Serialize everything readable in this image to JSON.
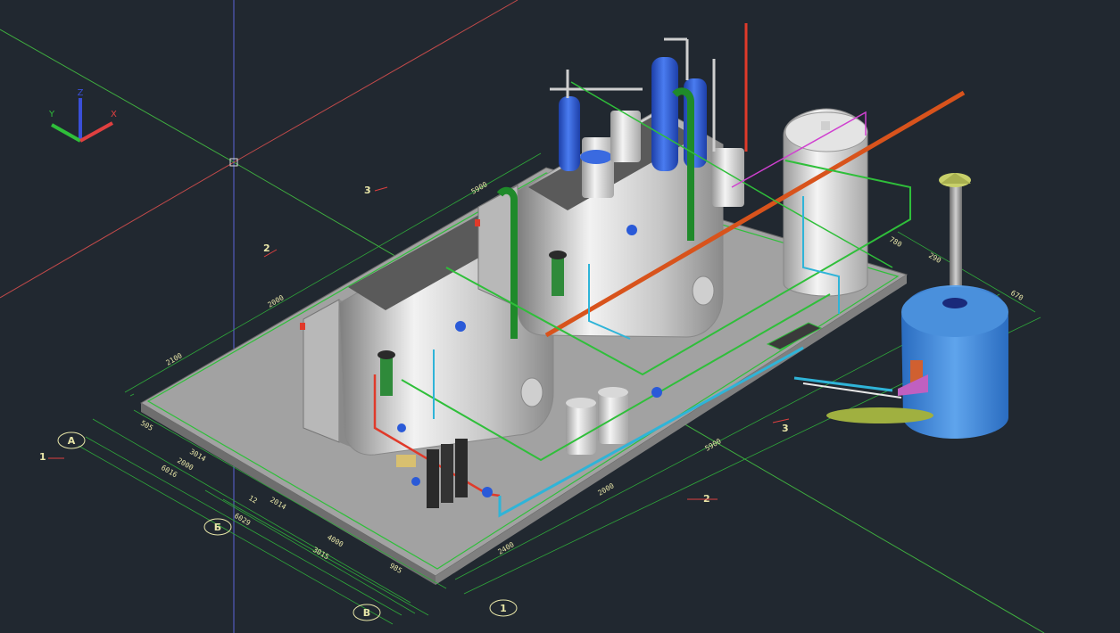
{
  "viewport": {
    "background": "#212830",
    "colors": {
      "platform": "#9c9c9c",
      "platform_edge": "#6e6e6e",
      "boiler": "#d8d8d8",
      "boiler_dark": "#8e8e8e",
      "tank_blue": "#2d5fd6",
      "furnace_blue": "#3b86d8",
      "pipe_red": "#e03a2a",
      "pipe_green": "#2fbf3a",
      "pipe_cyan": "#2fb4d8",
      "pipe_orange": "#d8531c",
      "dim_green": "#2fa83a",
      "dim_text": "#e8e6a8",
      "grid_red": "#c24a4a",
      "grid_green": "#3fae3f",
      "grid_blue": "#5c63d8"
    }
  },
  "ucs_icon": {
    "x_label": "X",
    "y_label": "Y",
    "z_label": "Z"
  },
  "grid_bubbles": {
    "a": "A",
    "b": "Б",
    "v": "В",
    "one": "1"
  },
  "dimensions": {
    "top_5900": "5900",
    "left_2000": "2000",
    "left_2100": "2100",
    "front_2000": "2000",
    "front_2400": "2400",
    "front_5900": "5900",
    "right_780": "780",
    "right_290": "290",
    "right_670": "670",
    "left_505": "505",
    "left_3014": "3014",
    "left_2000b": "2000",
    "left_6016": "6016",
    "left_12": "12",
    "left_2014": "2014",
    "left_6029": "6029",
    "left_4000": "4000",
    "left_3015": "3015",
    "left_985": "985",
    "plate_800": "800"
  },
  "section_marks": {
    "s1": "1",
    "s2": "2",
    "s3": "3",
    "s1b": "1",
    "s2b": "2",
    "s3b": "3"
  }
}
